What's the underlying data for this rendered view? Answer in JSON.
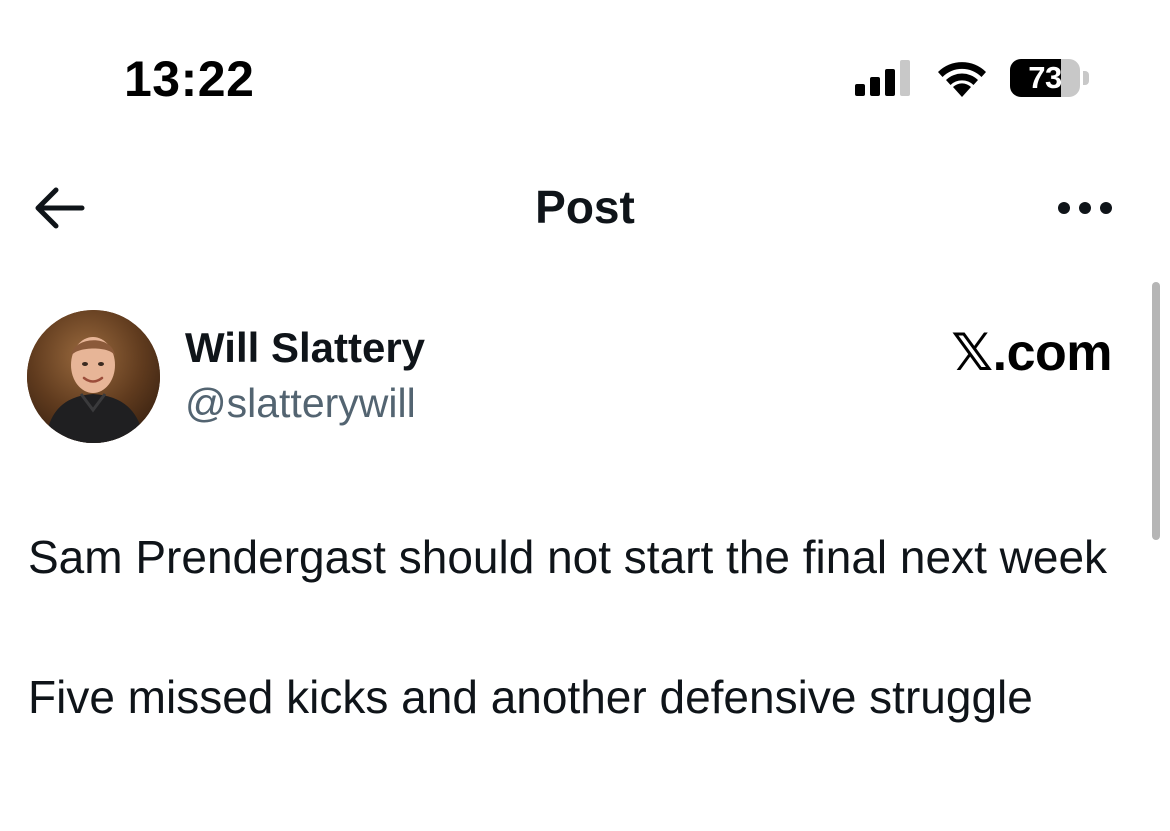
{
  "status_bar": {
    "time": "13:22",
    "battery_percent": 73,
    "battery_label": "73",
    "signal_icon": "cellular-signal-icon",
    "wifi_icon": "wifi-icon"
  },
  "header": {
    "title": "Post",
    "back_icon": "back-arrow-icon",
    "more_icon": "more-options-icon"
  },
  "post": {
    "author": {
      "name": "Will Slattery",
      "handle": "@slatterywill",
      "avatar_icon": "avatar-photo"
    },
    "source_logo": "𝕏.com",
    "paragraphs": [
      "Sam Prendergast should not start the final next week",
      "Five missed kicks and another defensive struggle"
    ]
  },
  "colors": {
    "text_primary": "#0f1419",
    "text_secondary": "#536471",
    "background": "#ffffff"
  }
}
